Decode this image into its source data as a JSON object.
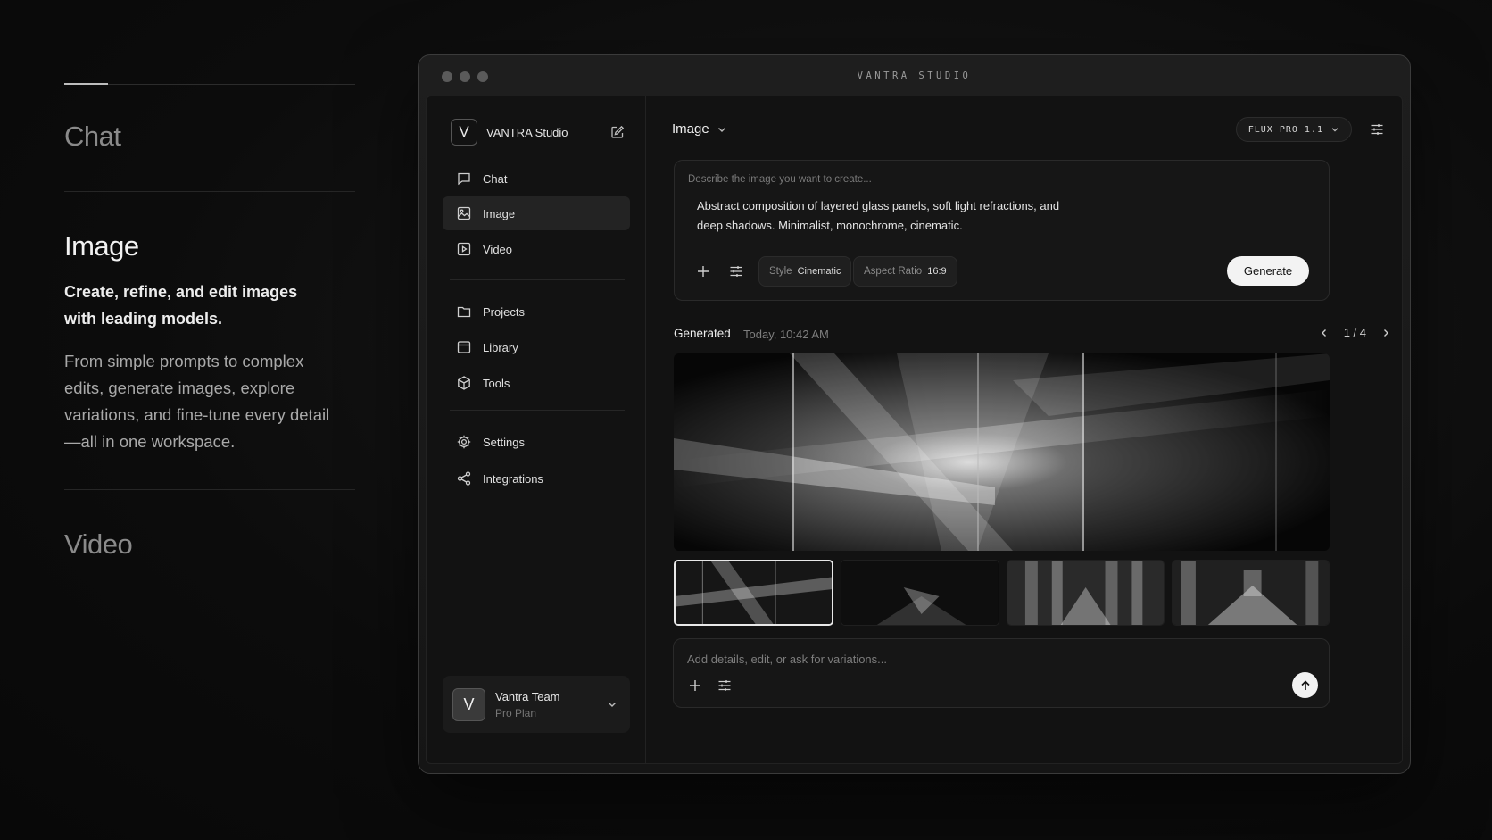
{
  "features": {
    "items": [
      {
        "title": "Chat"
      },
      {
        "title": "Image",
        "subtitle": "Create, refine, and edit images with leading models.",
        "body": "From simple prompts to complex edits, generate images, explore variations, and fine-tune every detail—all in one workspace."
      },
      {
        "title": "Video"
      }
    ],
    "progress": 0.15
  },
  "window": {
    "title": "VANTRA STUDIO"
  },
  "sidebar": {
    "brand_initial": "V",
    "brand_name": "VANTRA Studio",
    "nav": [
      {
        "label": "Chat",
        "icon": "chat-icon"
      },
      {
        "label": "Image",
        "icon": "image-icon",
        "active": true
      },
      {
        "label": "Video",
        "icon": "video-icon"
      },
      {
        "label": "Projects",
        "icon": "folder-icon"
      },
      {
        "label": "Library",
        "icon": "library-icon"
      },
      {
        "label": "Tools",
        "icon": "cube-icon"
      },
      {
        "label": "Settings",
        "icon": "gear-icon"
      },
      {
        "label": "Integrations",
        "icon": "share-icon"
      }
    ],
    "account": {
      "initial": "V",
      "name": "Vantra Team",
      "plan": "Pro Plan"
    }
  },
  "main": {
    "mode": "Image",
    "model": "FLUX PRO 1.1",
    "prompt": {
      "placeholder": "Describe the image you want to create...",
      "text": "Abstract composition of layered glass panels, soft light refractions, and deep shadows. Minimalist, monochrome, cinematic.",
      "style_key": "Style",
      "style_value": "Cinematic",
      "aspect_key": "Aspect Ratio",
      "aspect_value": "16:9",
      "generate_label": "Generate"
    },
    "generated": {
      "label": "Generated",
      "time": "Today, 10:42 AM",
      "pager": "1 / 4",
      "selected_index": 0
    },
    "chat": {
      "placeholder": "Add details, edit, or ask for variations..."
    }
  },
  "colors": {
    "background": "#0c0c0c",
    "panel": "#121212",
    "accent": "#f3f3f3",
    "muted_text": "#7a7a7a"
  }
}
